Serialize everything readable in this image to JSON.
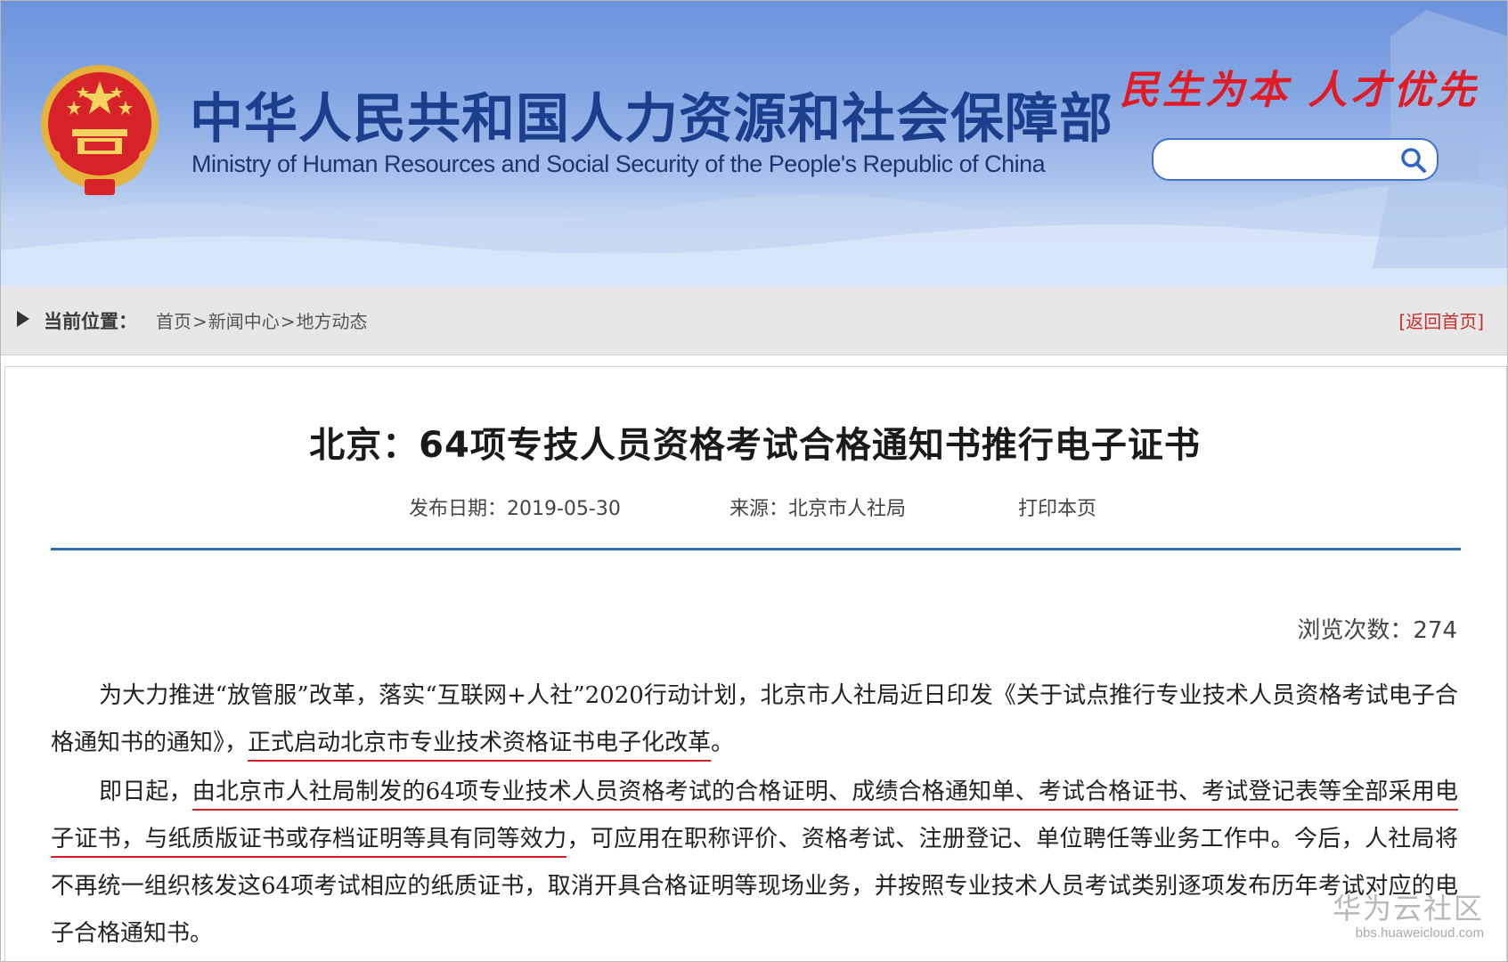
{
  "header": {
    "title_cn": "中华人民共和国人力资源和社会保障部",
    "title_en": "Ministry of Human Resources and Social Security of the People's Republic of China",
    "slogan": "民生为本 人才优先",
    "search": {
      "placeholder": "",
      "value": ""
    },
    "icons": {
      "emblem": "national-emblem",
      "search": "search-icon"
    }
  },
  "breadcrumb": {
    "label": "当前位置：",
    "items": [
      "首页",
      "新闻中心",
      "地方动态"
    ],
    "separator": ">",
    "home_link": "[返回首页]"
  },
  "article": {
    "title": "北京：64项专技人员资格考试合格通知书推行电子证书",
    "publish_date": "发布日期：2019-05-30",
    "source": "来源：北京市人社局",
    "print": "打印本页",
    "views": "浏览次数：274",
    "paragraphs": [
      {
        "before": "为大力推进“放管服”改革，落实“互联网+人社”2020行动计划，北京市人社局近日印发《关于试点推行专业技术人员资格考试电子合格通知书的通知》，",
        "underlined": "正式启动北京市专业技术资格证书电子化改革",
        "after": "。"
      },
      {
        "before": "即日起，",
        "underlined": "由北京市人社局制发的64项专业技术人员资格考试的合格证明、成绩合格通知单、考试合格证书、考试登记表等全部采用电子证书，与纸质版证书或存档证明等具有同等效力",
        "after": "，可应用在职称评价、资格考试、注册登记、单位聘任等业务工作中。今后，人社局将不再统一组织核发这64项考试相应的纸质证书，取消开具合格证明等现场业务，并按照专业技术人员考试类别逐项发布历年考试对应的电子合格通知书。"
      }
    ]
  },
  "watermark": {
    "name": "华为云社区",
    "url": "bbs.huaweicloud.com"
  },
  "colors": {
    "header_blue": "#6d93dc",
    "title_blue": "#1b3e8d",
    "slogan_red": "#e11b24",
    "rule_blue": "#2f6fb0",
    "underline_red": "#d21f1f",
    "home_link_red": "#c62e2e"
  }
}
